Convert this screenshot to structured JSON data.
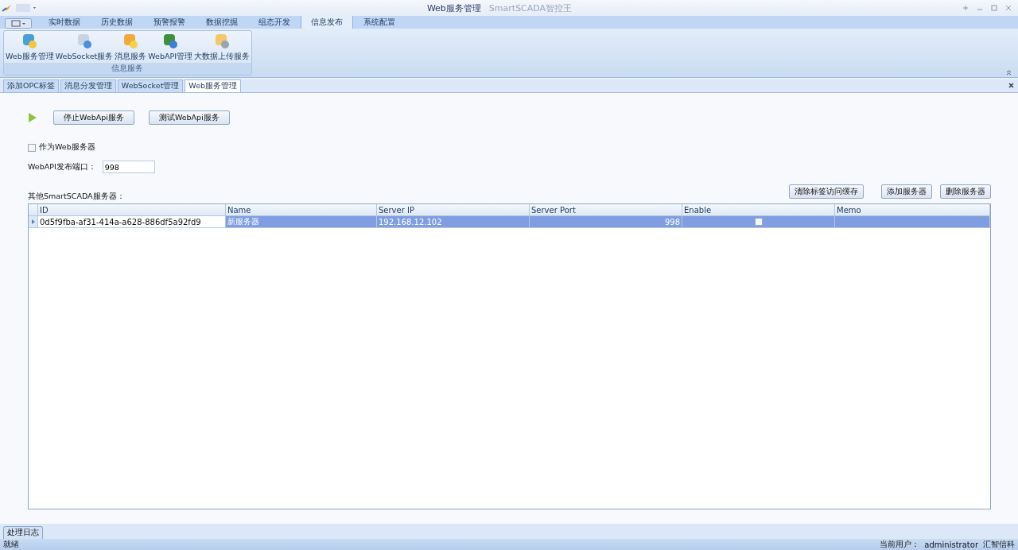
{
  "window": {
    "title": "Web服务管理",
    "subtitle": "SmartSCADA智控王"
  },
  "ribbon_tabs": [
    {
      "label": "实时数据",
      "selected": false
    },
    {
      "label": "历史数据",
      "selected": false
    },
    {
      "label": "预警报警",
      "selected": false
    },
    {
      "label": "数据挖掘",
      "selected": false
    },
    {
      "label": "组态开发",
      "selected": false
    },
    {
      "label": "信息发布",
      "selected": true
    },
    {
      "label": "系统配置",
      "selected": false
    }
  ],
  "ribbon_group": {
    "label": "信息服务",
    "buttons": [
      {
        "label": "Web服务管理",
        "kind": "web"
      },
      {
        "label": "WebSocket服务",
        "kind": "socket"
      },
      {
        "label": "消息服务",
        "kind": "message"
      },
      {
        "label": "WebAPI管理",
        "kind": "api"
      },
      {
        "label": "大数据上传服务",
        "kind": "upload"
      }
    ]
  },
  "doc_tabs": [
    {
      "label": "添加OPC标签",
      "selected": false
    },
    {
      "label": "消息分发管理",
      "selected": false
    },
    {
      "label": "WebSocket管理",
      "selected": false
    },
    {
      "label": "Web服务管理",
      "selected": true
    }
  ],
  "service": {
    "running": true,
    "stop_button": "停止WebApi服务",
    "test_button": "测试WebApi服务"
  },
  "as_web_server": {
    "label": "作为Web服务器",
    "checked": false
  },
  "port": {
    "label": "WebAPI发布端口：",
    "value": "998"
  },
  "servers": {
    "label": "其他SmartSCADA服务器：",
    "buttons": [
      "清除标签访问缓存",
      "添加服务器",
      "删除服务器"
    ],
    "columns": [
      "ID",
      "Name",
      "Server IP",
      "Server Port",
      "Enable",
      "Memo"
    ],
    "rows": [
      {
        "id": "0d5f9fba-af31-414a-a628-886df5a92fd9",
        "name": "新服务器",
        "ip": "192.168.12.102",
        "port": "998",
        "enable": false,
        "memo": "",
        "selected": true
      }
    ]
  },
  "bottom_tab": "处理日志",
  "status_bar": {
    "left": "就绪",
    "user_label": "当前用户：",
    "user": "administrator",
    "company": "汇智信科"
  }
}
